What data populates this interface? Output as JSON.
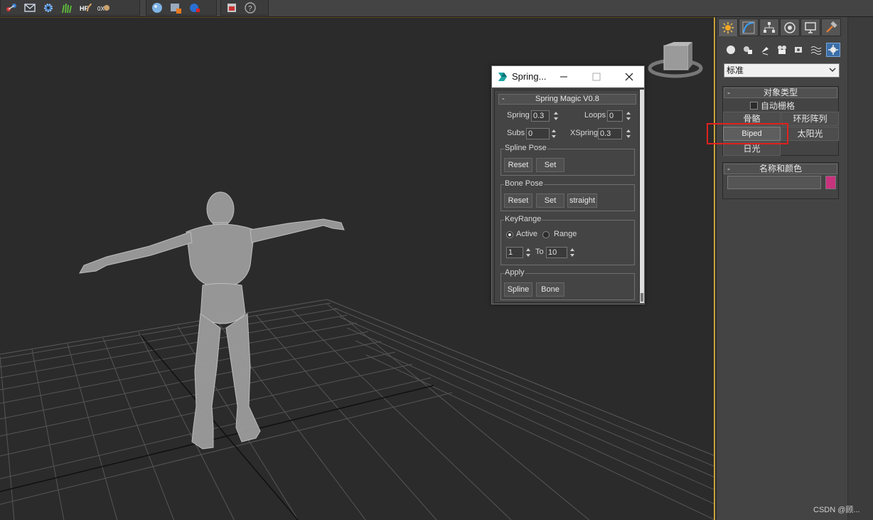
{
  "toolbar": {
    "icons": [
      "molecule-icon",
      "envelope-icon",
      "gear-icon",
      "grass-icon",
      "hf-icon",
      "cylinder-icon",
      "sphere-render-icon",
      "render-setup-icon",
      "render-sphere-icon",
      "render-frame-icon",
      "help-icon"
    ],
    "hf_label": "HF",
    "ox_label": "0X"
  },
  "command_panel": {
    "tabs": [
      "create-tab",
      "modify-tab",
      "hierarchy-tab",
      "motion-tab",
      "display-tab",
      "utilities-tab"
    ],
    "sub_icons": [
      "geometry-icon",
      "shapes-icon",
      "lights-icon",
      "cameras-icon",
      "helpers-icon",
      "spacewarps-icon",
      "systems-icon"
    ],
    "dropdown_value": "标准",
    "object_type": {
      "header": "对象类型",
      "autogrid_label": "自动栅格",
      "buttons": [
        "骨骼",
        "环形阵列",
        "Biped",
        "太阳光",
        "日光"
      ]
    },
    "name_color": {
      "header": "名称和颜色",
      "name_value": "",
      "swatch_color": "#c8337e"
    },
    "minus": "-"
  },
  "dialog": {
    "title": "Spring...",
    "header": "Spring Magic V0.8",
    "minus": "-",
    "spring_label": "Spring",
    "spring_value": "0.3",
    "loops_label": "Loops",
    "loops_value": "0",
    "subs_label": "Subs",
    "subs_value": "0",
    "xspring_label": "XSpring",
    "xspring_value": "0.3",
    "spline_pose": {
      "title": "Spline Pose",
      "reset": "Reset",
      "set": "Set"
    },
    "bone_pose": {
      "title": "Bone Pose",
      "reset": "Reset",
      "set": "Set",
      "straight": "straight"
    },
    "key_range": {
      "title": "KeyRange",
      "active": "Active",
      "range": "Range",
      "from": "1",
      "to_label": "To",
      "to": "10"
    },
    "apply": {
      "title": "Apply",
      "spline": "Spline",
      "bone": "Bone"
    }
  },
  "watermark": "CSDN @顾..."
}
